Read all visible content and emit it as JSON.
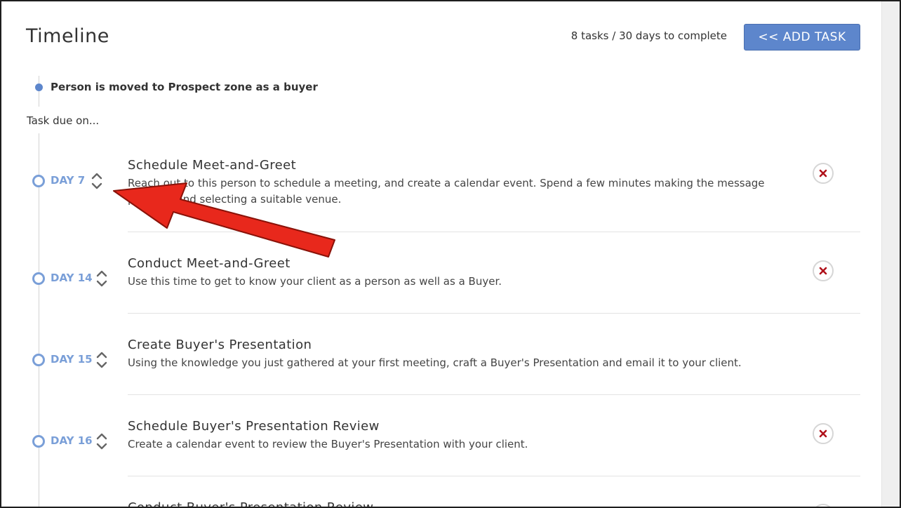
{
  "header": {
    "title": "Timeline",
    "task_summary": "8 tasks / 30 days to complete",
    "add_task_label": "<< ADD TASK"
  },
  "timeline": {
    "trigger_text": "Person is moved to Prospect zone as a buyer",
    "due_label": "Task due on..."
  },
  "tasks": [
    {
      "day": "DAY 7",
      "title": "Schedule Meet-and-Greet",
      "description": "Reach out to this person to schedule a meeting, and create a calendar event. Spend a few minutes making the message personal and selecting a suitable venue.",
      "removable": true
    },
    {
      "day": "DAY 14",
      "title": "Conduct Meet-and-Greet",
      "description": "Use this time to get to know your client as a person as well as a Buyer.",
      "removable": true
    },
    {
      "day": "DAY 15",
      "title": "Create Buyer's Presentation",
      "description": "Using the knowledge you just gathered at your first meeting, craft a Buyer's Presentation and email it to your client.",
      "removable": false
    },
    {
      "day": "DAY 16",
      "title": "Schedule Buyer's Presentation Review",
      "description": "Create a calendar event to review the Buyer's Presentation with your client.",
      "removable": true
    },
    {
      "day": "",
      "title": "Conduct Buyer's Presentation Review",
      "description": "",
      "removable": true
    }
  ],
  "colors": {
    "accent": "#5d86cc",
    "day_label": "#7a9fd8",
    "remove_x": "#b0121b",
    "annotation_arrow": "#e8281c"
  }
}
